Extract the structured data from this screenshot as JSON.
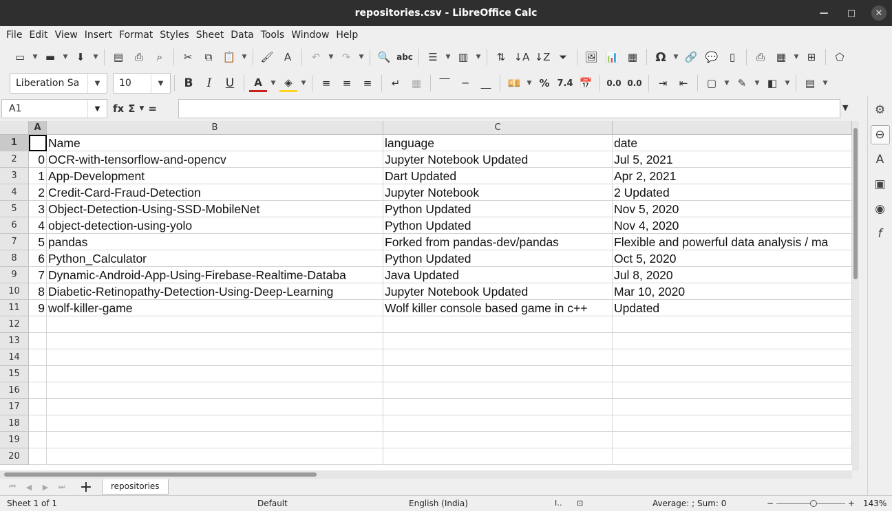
{
  "window": {
    "title": "repositories.csv - LibreOffice Calc"
  },
  "menu": [
    "File",
    "Edit",
    "View",
    "Insert",
    "Format",
    "Styles",
    "Sheet",
    "Data",
    "Tools",
    "Window",
    "Help"
  ],
  "toolbar": {
    "font_name": "Liberation Sa",
    "font_size": "10",
    "percent_label": "%",
    "number_label": "7.4",
    "bold_label": "B",
    "italic_label": "I",
    "underline_label": "U",
    "special_char_label": "Ω"
  },
  "formula_bar": {
    "name_box": "A1",
    "fx_label": "fx",
    "sum_label": "Σ",
    "equals_label": "=",
    "content": ""
  },
  "columns": [
    {
      "label": "A",
      "selected": true
    },
    {
      "label": "B",
      "selected": false
    },
    {
      "label": "C",
      "selected": false
    },
    {
      "label": "",
      "selected": false
    }
  ],
  "rows": [
    {
      "num": "1",
      "a": "",
      "b": "Name",
      "c": "language",
      "d": "date"
    },
    {
      "num": "2",
      "a": "0",
      "b": "OCR-with-tensorflow-and-opencv",
      "c": "Jupyter Notebook Updated",
      "d": "Jul 5, 2021"
    },
    {
      "num": "3",
      "a": "1",
      "b": "App-Development",
      "c": "Dart Updated",
      "d": "Apr 2, 2021"
    },
    {
      "num": "4",
      "a": "2",
      "b": "Credit-Card-Fraud-Detection",
      "c": "Jupyter Notebook",
      "d": "2 Updated"
    },
    {
      "num": "5",
      "a": "3",
      "b": "Object-Detection-Using-SSD-MobileNet",
      "c": "Python Updated",
      "d": "Nov 5, 2020"
    },
    {
      "num": "6",
      "a": "4",
      "b": "object-detection-using-yolo",
      "c": "Python Updated",
      "d": "Nov 4, 2020"
    },
    {
      "num": "7",
      "a": "5",
      "b": "pandas",
      "c": "Forked from pandas-dev/pandas",
      "d": "Flexible and powerful data analysis / ma"
    },
    {
      "num": "8",
      "a": "6",
      "b": "Python_Calculator",
      "c": "Python Updated",
      "d": "Oct 5, 2020"
    },
    {
      "num": "9",
      "a": "7",
      "b": "Dynamic-Android-App-Using-Firebase-Realtime-Databa",
      "c": "Java Updated",
      "d": "Jul 8, 2020"
    },
    {
      "num": "10",
      "a": "8",
      "b": "Diabetic-Retinopathy-Detection-Using-Deep-Learning",
      "c": "Jupyter Notebook Updated",
      "d": "Mar 10, 2020"
    },
    {
      "num": "11",
      "a": "9",
      "b": "wolf-killer-game",
      "c": "Wolf killer console based game in c++",
      "d": "Updated"
    },
    {
      "num": "12",
      "a": "",
      "b": "",
      "c": "",
      "d": ""
    },
    {
      "num": "13",
      "a": "",
      "b": "",
      "c": "",
      "d": ""
    },
    {
      "num": "14",
      "a": "",
      "b": "",
      "c": "",
      "d": ""
    },
    {
      "num": "15",
      "a": "",
      "b": "",
      "c": "",
      "d": ""
    },
    {
      "num": "16",
      "a": "",
      "b": "",
      "c": "",
      "d": ""
    },
    {
      "num": "17",
      "a": "",
      "b": "",
      "c": "",
      "d": ""
    },
    {
      "num": "18",
      "a": "",
      "b": "",
      "c": "",
      "d": ""
    },
    {
      "num": "19",
      "a": "",
      "b": "",
      "c": "",
      "d": ""
    },
    {
      "num": "20",
      "a": "",
      "b": "",
      "c": "",
      "d": ""
    }
  ],
  "sheet_tabs": [
    "repositories"
  ],
  "status": {
    "sheet": "Sheet 1 of 1",
    "style": "Default",
    "language": "English (India)",
    "summary": "Average: ; Sum: 0",
    "zoom": "143%",
    "zoom_minus": "−",
    "zoom_plus": "+"
  }
}
